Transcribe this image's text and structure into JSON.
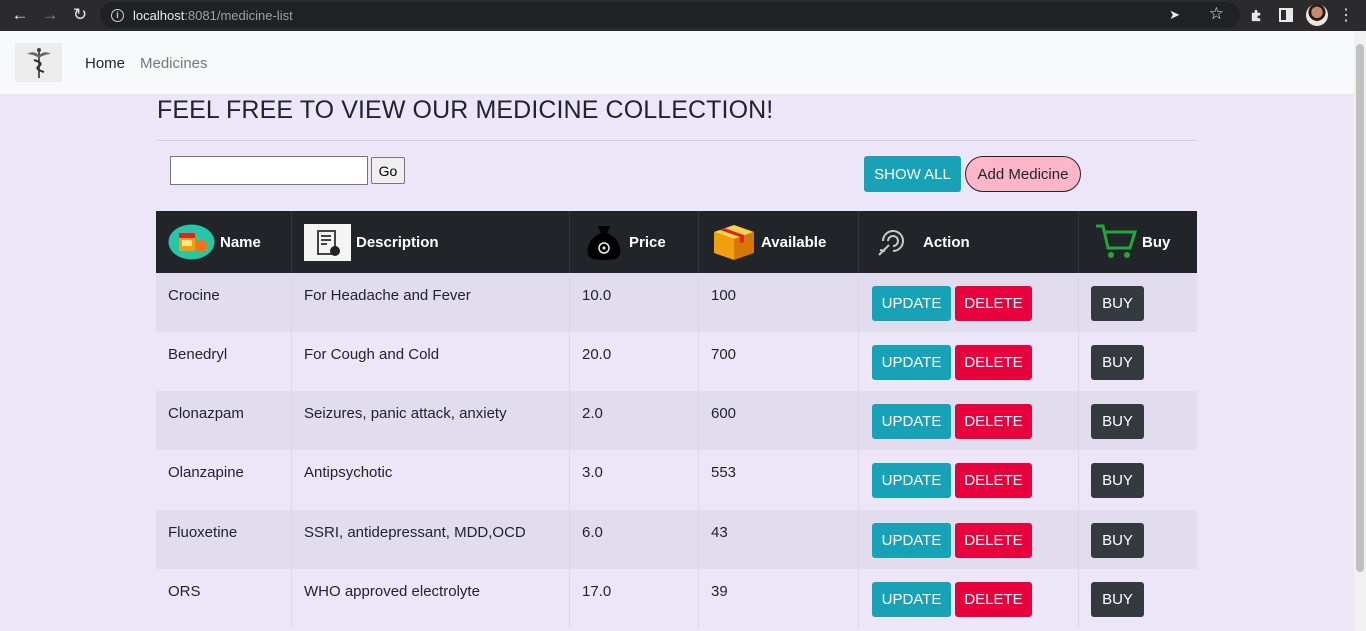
{
  "browser": {
    "url_host": "localhost",
    "url_rest": ":8081/medicine-list"
  },
  "navbar": {
    "home_label": "Home",
    "medicines_label": "Medicines"
  },
  "page": {
    "title": "FEEL FREE TO VIEW OUR MEDICINE COLLECTION!"
  },
  "search": {
    "value": "",
    "go_label": "Go"
  },
  "actions": {
    "show_all_label": "SHOW ALL",
    "add_medicine_label": "Add Medicine"
  },
  "table": {
    "headers": {
      "name": "Name",
      "description": "Description",
      "price": "Price",
      "available": "Available",
      "action": "Action",
      "buy": "Buy"
    },
    "rows": [
      {
        "name": "Crocine",
        "description": "For Headache and Fever",
        "price": "10.0",
        "available": "100"
      },
      {
        "name": "Benedryl",
        "description": "For Cough and Cold",
        "price": "20.0",
        "available": "700"
      },
      {
        "name": "Clonazpam",
        "description": "Seizures, panic attack, anxiety",
        "price": "2.0",
        "available": "600"
      },
      {
        "name": "Olanzapine",
        "description": "Antipsychotic",
        "price": "3.0",
        "available": "553"
      },
      {
        "name": "Fluoxetine",
        "description": "SSRI, antidepressant, MDD,OCD",
        "price": "6.0",
        "available": "43"
      },
      {
        "name": "ORS",
        "description": "WHO approved electrolyte",
        "price": "17.0",
        "available": "39"
      }
    ],
    "update_label": "UPDATE",
    "delete_label": "DELETE",
    "buy_label": "BUY"
  },
  "colors": {
    "page_bg": "#ece6f8",
    "update": "#17a2b8",
    "delete": "#e8003d",
    "buy": "#343a40",
    "header": "#212529",
    "add_medicine": "#ffb6c8"
  }
}
